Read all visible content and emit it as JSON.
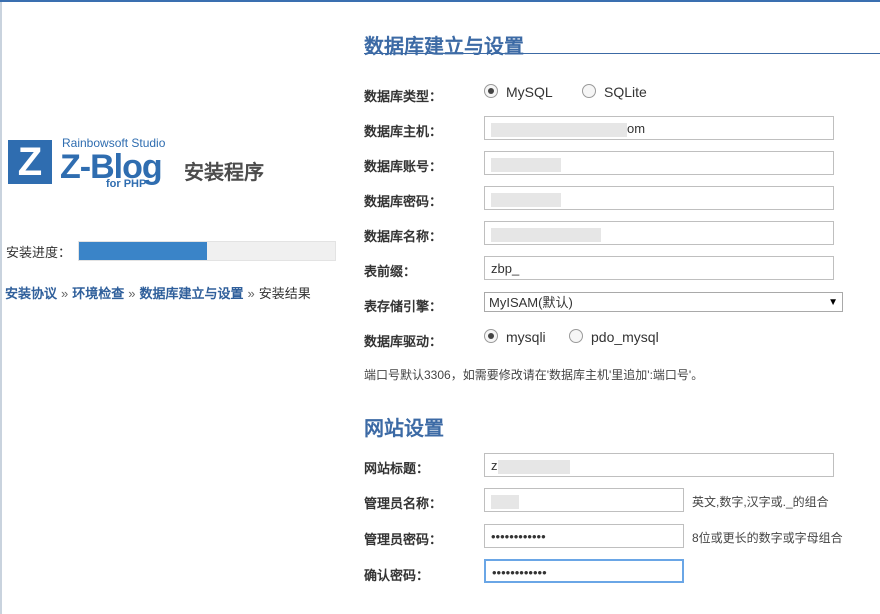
{
  "logo": {
    "badge": "Z",
    "studio": "Rainbowsoft Studio",
    "name": "Z-Blog",
    "for_php": "for PHP",
    "installer": "安装程序"
  },
  "progress": {
    "label": "安装进度：",
    "value_percent": 50
  },
  "steps": [
    {
      "label": "安装协议"
    },
    {
      "label": "环境检查"
    },
    {
      "label": "数据库建立与设置"
    },
    {
      "label": "安装结果"
    }
  ],
  "step_separator": "»",
  "db_section": {
    "title": "数据库建立与设置",
    "type_label": "数据库类型：",
    "type_options": [
      "MySQL",
      "SQLite"
    ],
    "type_selected": "MySQL",
    "host_label": "数据库主机：",
    "host_value_suffix": "om",
    "account_label": "数据库账号：",
    "password_label": "数据库密码：",
    "name_label": "数据库名称：",
    "prefix_label": "表前缀：",
    "prefix_value": "zbp_",
    "engine_label": "表存储引擎：",
    "engine_value": "MyISAM(默认)",
    "driver_label": "数据库驱动：",
    "driver_options": [
      "mysqli",
      "pdo_mysql"
    ],
    "driver_selected": "mysqli",
    "port_hint": "端口号默认3306，如需要修改请在'数据库主机'里追加':端口号'。"
  },
  "site_section": {
    "title": "网站设置",
    "site_title_label": "网站标题：",
    "site_title_prefix": "z",
    "admin_name_label": "管理员名称：",
    "admin_name_hint": "英文,数字,汉字或._的组合",
    "admin_password_label": "管理员密码：",
    "admin_password_value": "••••••••••••",
    "admin_password_hint": "8位或更长的数字或字母组合",
    "confirm_password_label": "确认密码：",
    "confirm_password_value": "••••••••••••"
  },
  "colors": {
    "accent": "#3c6aa5",
    "progress": "#3a84c8"
  }
}
